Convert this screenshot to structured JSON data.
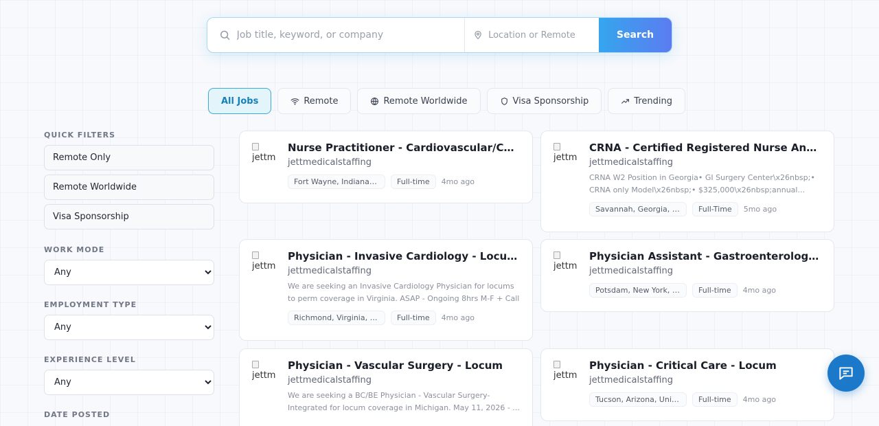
{
  "search": {
    "keyword_placeholder": "Job title, keyword, or company",
    "location_placeholder": "Location or Remote",
    "button_label": "Search"
  },
  "tabs": [
    {
      "label": "All Jobs",
      "icon": "none",
      "active": true
    },
    {
      "label": "Remote",
      "icon": "wifi-icon",
      "active": false
    },
    {
      "label": "Remote Worldwide",
      "icon": "globe-icon",
      "active": false
    },
    {
      "label": "Visa Sponsorship",
      "icon": "shield-icon",
      "active": false
    },
    {
      "label": "Trending",
      "icon": "trending-up-icon",
      "active": false
    }
  ],
  "sidebar": {
    "quick_filters_title": "QUICK FILTERS",
    "quick_filters": [
      "Remote Only",
      "Remote Worldwide",
      "Visa Sponsorship"
    ],
    "work_mode_title": "WORK MODE",
    "work_mode_value": "Any",
    "employment_type_title": "EMPLOYMENT TYPE",
    "employment_type_value": "Any",
    "experience_level_title": "EXPERIENCE LEVEL",
    "experience_level_value": "Any",
    "date_posted_title": "DATE POSTED"
  },
  "jobs": [
    {
      "logo_alt": "jettm",
      "title": "Nurse Practitioner - Cardiovascular/Cardiothoracic Surgery",
      "company": "jettmedicalstaffing",
      "description": "",
      "location": "Fort Wayne, Indiana, United States",
      "type": "Full-time",
      "ago": "4mo ago"
    },
    {
      "logo_alt": "jettm",
      "title": "CRNA - Certified Registered Nurse Anesthetist",
      "company": "jettmedicalstaffing",
      "description": "CRNA W2 Position in Georgia• GI Surgery Center\\x26nbsp;• CRNA only Model\\x26nbsp;• $325,000\\x26nbsp;annual...",
      "location": "Savannah, Georgia, United States",
      "type": "Full-Time",
      "ago": "5mo ago"
    },
    {
      "logo_alt": "jettm",
      "title": "Physician - Invasive Cardiology - Locums to perm",
      "company": "jettmedicalstaffing",
      "description": "We are seeking an Invasive Cardiology Physician for locums to perm coverage in Virginia. ASAP - Ongoing 8hrs M-F + Call",
      "location": "Richmond, Virginia, United States",
      "type": "Full-time",
      "ago": "4mo ago"
    },
    {
      "logo_alt": "jettm",
      "title": "Physician Assistant - Gastroenterology - Locum",
      "company": "jettmedicalstaffing",
      "description": "",
      "location": "Potsdam, New York, United States",
      "type": "Full-time",
      "ago": "4mo ago"
    },
    {
      "logo_alt": "jettm",
      "title": "Physician - Vascular Surgery - Locum",
      "company": "jettmedicalstaffing",
      "description": "We are seeking a BC/BE Physician - Vascular Surgery-Integrated for locum coverage in Michigan. May 11, 2026 - ...",
      "location": "",
      "type": "",
      "ago": ""
    },
    {
      "logo_alt": "jettm",
      "title": "Physician - Critical Care - Locum",
      "company": "jettmedicalstaffing",
      "description": "",
      "location": "Tucson, Arizona, United States",
      "type": "Full-time",
      "ago": "4mo ago"
    }
  ]
}
